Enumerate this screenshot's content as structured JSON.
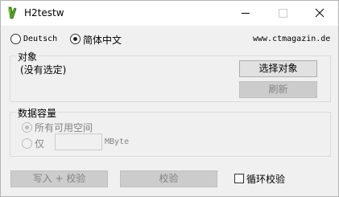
{
  "window": {
    "title": "H2testw"
  },
  "language": {
    "options": [
      "Deutsch",
      "简体中文"
    ],
    "selected": "简体中文"
  },
  "website": "www.ctmagazin.de",
  "target": {
    "group_label": "对象",
    "status": "(没有选定)",
    "select_button": "选择对象",
    "refresh_button": "刷新"
  },
  "data_volume": {
    "group_label": "数据容量",
    "all_space_label": "所有可用空间",
    "only_label": "仅",
    "size_value": "",
    "unit": "MByte"
  },
  "footer": {
    "write_verify_button": "写入 + 校验",
    "verify_button": "校验",
    "loop_label": "循环校验",
    "loop_checked": false
  }
}
